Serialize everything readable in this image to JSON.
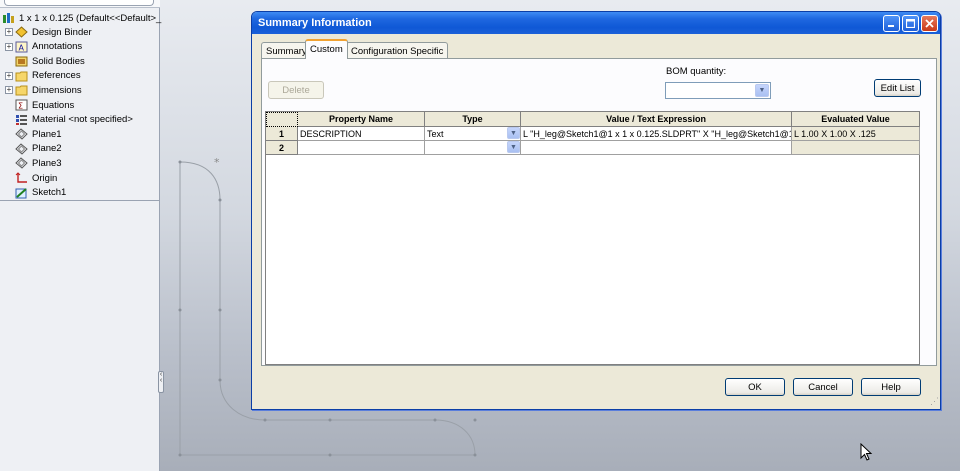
{
  "tree": {
    "root_label": "1 x 1 x 0.125  (Default<<Default>_",
    "items": [
      {
        "label": "Design Binder",
        "icon": "design-binder-icon",
        "expandable": true
      },
      {
        "label": "Annotations",
        "icon": "annotations-icon",
        "expandable": true
      },
      {
        "label": "Solid Bodies",
        "icon": "solid-bodies-icon",
        "expandable": false
      },
      {
        "label": "References",
        "icon": "folder-icon",
        "expandable": true
      },
      {
        "label": "Dimensions",
        "icon": "folder-icon",
        "expandable": true
      },
      {
        "label": "Equations",
        "icon": "equations-icon",
        "expandable": false
      },
      {
        "label": "Material <not specified>",
        "icon": "material-icon",
        "expandable": false
      },
      {
        "label": "Plane1",
        "icon": "plane-icon",
        "expandable": false
      },
      {
        "label": "Plane2",
        "icon": "plane-icon",
        "expandable": false
      },
      {
        "label": "Plane3",
        "icon": "plane-icon",
        "expandable": false
      },
      {
        "label": "Origin",
        "icon": "origin-icon",
        "expandable": false
      },
      {
        "label": "Sketch1",
        "icon": "sketch-icon",
        "expandable": false
      }
    ]
  },
  "dialog": {
    "title": "Summary Information",
    "tabs": [
      "Summary",
      "Custom",
      "Configuration Specific"
    ],
    "active_tab": "Custom",
    "delete_label": "Delete",
    "bom_label": "BOM quantity:",
    "bom_value": "",
    "edit_list_label": "Edit List",
    "columns": [
      "Property Name",
      "Type",
      "Value / Text Expression",
      "Evaluated Value"
    ],
    "rows": [
      {
        "num": "1",
        "name": "DESCRIPTION",
        "type": "Text",
        "value": "L \"H_leg@Sketch1@1 x 1 x 0.125.SLDPRT\" X \"H_leg@Sketch1@1",
        "evaluated": "L 1.00 X 1.00 X .125"
      },
      {
        "num": "2",
        "name": "",
        "type": "",
        "value": "",
        "evaluated": ""
      }
    ],
    "ok_label": "OK",
    "cancel_label": "Cancel",
    "help_label": "Help"
  },
  "colors": {
    "titlebar": "#0f58d6",
    "dialog_bg": "#ece9d8",
    "tab_highlight": "#f1a232"
  }
}
